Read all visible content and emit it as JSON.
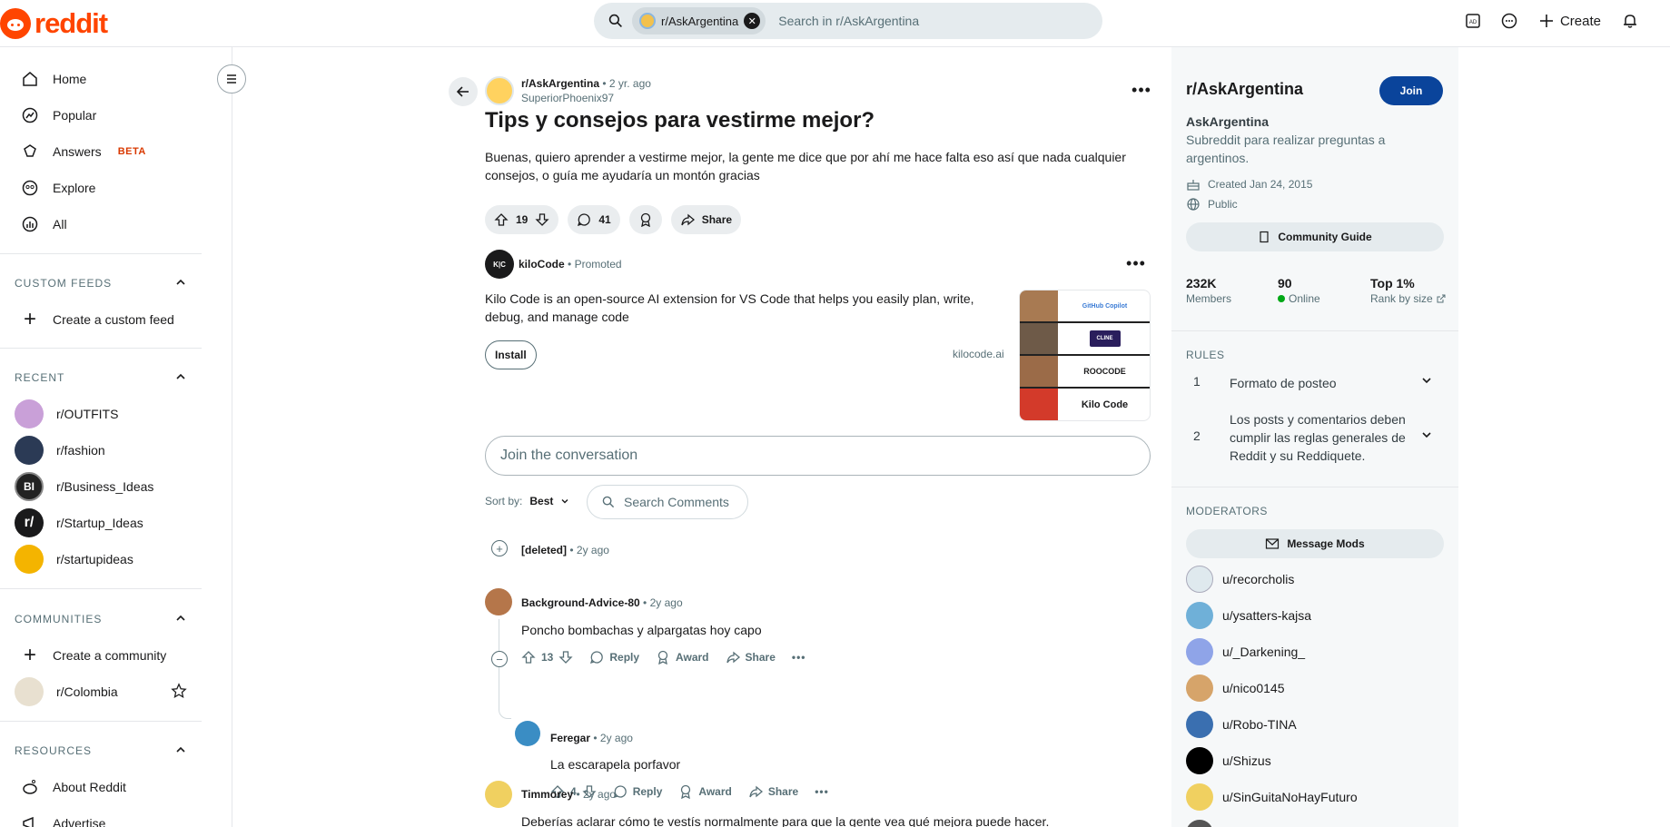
{
  "header": {
    "logo_text": "reddit",
    "search_chip": "r/AskArgentina",
    "search_placeholder": "Search in r/AskArgentina",
    "create_label": "Create"
  },
  "sidebar": {
    "nav": [
      {
        "label": "Home",
        "icon": "home-icon"
      },
      {
        "label": "Popular",
        "icon": "popular-icon"
      },
      {
        "label": "Answers",
        "badge": "BETA",
        "icon": "answers-icon"
      },
      {
        "label": "Explore",
        "icon": "explore-icon"
      },
      {
        "label": "All",
        "icon": "all-icon"
      }
    ],
    "custom_feeds": {
      "title": "CUSTOM FEEDS",
      "create_label": "Create a custom feed"
    },
    "recent": {
      "title": "RECENT",
      "items": [
        "r/OUTFITS",
        "r/fashion",
        "r/Business_Ideas",
        "r/Startup_Ideas",
        "r/startupideas"
      ]
    },
    "communities": {
      "title": "COMMUNITIES",
      "create_label": "Create a community",
      "items": [
        "r/Colombia"
      ]
    },
    "resources": {
      "title": "RESOURCES",
      "items": [
        "About Reddit",
        "Advertise"
      ]
    }
  },
  "post": {
    "subreddit": "r/AskArgentina",
    "time": "2 yr. ago",
    "author": "SuperiorPhoenix97",
    "title": "Tips y consejos para vestirme mejor?",
    "body": "Buenas, quiero aprender a vestirme mejor, la gente me dice que por ahí me hace falta eso así que nada cualquier consejos, o guía me ayudaría un montón gracias",
    "votes": "19",
    "comments": "41",
    "share_label": "Share"
  },
  "ad": {
    "name": "kiloCode",
    "promoted": "Promoted",
    "text": "Kilo Code is an open-source AI extension for VS Code that helps you easily plan, write, debug, and manage code",
    "install_label": "Install",
    "domain": "kilocode.ai",
    "image_labels": [
      "GitHub Copilot",
      "CLINE",
      "ROOCODE",
      "Kilo Code"
    ]
  },
  "conversation": {
    "placeholder": "Join the conversation",
    "sort_label": "Sort by:",
    "sort_value": "Best",
    "search_comments": "Search Comments"
  },
  "comments": [
    {
      "author": "[deleted]",
      "time": "2y ago"
    },
    {
      "author": "Background-Advice-80",
      "time": "2y ago",
      "text": "Poncho bombachas y alpargatas hoy capo",
      "votes": "13"
    },
    {
      "author": "Feregar",
      "time": "2y ago",
      "text": "La escarapela porfavor",
      "votes": "4"
    },
    {
      "author": "Timmorey",
      "time": "2y ago",
      "text": "Deberías aclarar cómo te vestís normalmente para que la gente vea qué mejora puede hacer."
    }
  ],
  "comment_actions": {
    "reply": "Reply",
    "award": "Award",
    "share": "Share"
  },
  "rightbar": {
    "title": "r/AskArgentina",
    "join_label": "Join",
    "name": "AskArgentina",
    "description": "Subreddit para realizar preguntas a argentinos.",
    "created": "Created Jan 24, 2015",
    "visibility": "Public",
    "guide_label": "Community Guide",
    "stats": [
      {
        "value": "232K",
        "label": "Members"
      },
      {
        "value": "90",
        "label": "Online"
      },
      {
        "value": "Top 1%",
        "label": "Rank by size"
      }
    ],
    "rules_title": "RULES",
    "rules": [
      {
        "num": "1",
        "text": "Formato de posteo"
      },
      {
        "num": "2",
        "text": "Los posts y comentarios deben cumplir las reglas generales de Reddit y su Reddiquete."
      }
    ],
    "mods_title": "MODERATORS",
    "message_mods": "Message Mods",
    "mods": [
      "u/recorcholis",
      "u/ysatters-kajsa",
      "u/_Darkening_",
      "u/nico0145",
      "u/Robo-TINA",
      "u/Shizus",
      "u/SinGuitaNoHayFuturo"
    ]
  }
}
